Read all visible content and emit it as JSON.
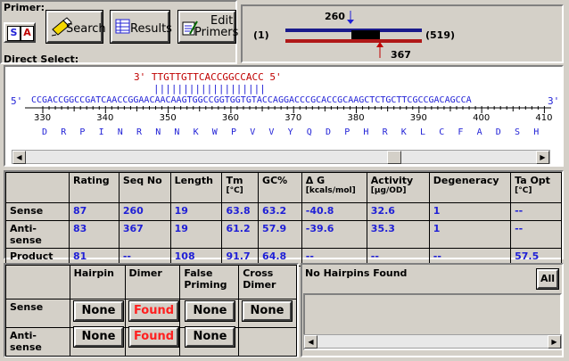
{
  "toolbar": {
    "primer_label": "Primer:",
    "sense_btn": "S",
    "antisense_btn": "A",
    "search_label": "Search",
    "results_label": "Results",
    "edit_primers_label_1": "Edit",
    "edit_primers_label_2": "Primers",
    "direct_select_label": "Direct Select:"
  },
  "map": {
    "top_pos": "260",
    "bottom_pos": "367",
    "start": "(1)",
    "end": "(519)"
  },
  "sequence": {
    "antisense_primer": "3' TTGTTGTTCACCGGCCACC 5'",
    "ticks": "|||||||||||||||||||",
    "left_end": "5'",
    "right_end": "3'",
    "dna": "CCGACCGGCCGATCAACCGGAACAACAAGTGGCCGGTGGTGTACCAGGACCCGCACCGCAAGCTCTGCTTCGCCGACAGCCA",
    "ruler": [
      "330",
      "340",
      "350",
      "360",
      "370",
      "380",
      "390",
      "400",
      "410"
    ],
    "protein": [
      "D",
      "R",
      "P",
      "I",
      "N",
      "R",
      "N",
      "N",
      "K",
      "W",
      "P",
      "V",
      "V",
      "Y",
      "Q",
      "D",
      "P",
      "H",
      "R",
      "K",
      "L",
      "C",
      "F",
      "A",
      "D",
      "S",
      "H"
    ]
  },
  "results": {
    "headers": [
      "",
      "Rating",
      "Seq No",
      "Length",
      "Tm",
      "GC%",
      "Δ G",
      "Activity",
      "Degeneracy",
      "Ta Opt"
    ],
    "subheaders": [
      "",
      "",
      "",
      "",
      "[°C]",
      "",
      "[kcals/mol]",
      "[µg/OD]",
      "",
      "[°C]"
    ],
    "rows": [
      {
        "label": "Sense",
        "values": [
          "87",
          "260",
          "19",
          "63.8",
          "63.2",
          "-40.8",
          "32.6",
          "1",
          "--"
        ]
      },
      {
        "label": "Anti-sense",
        "values": [
          "83",
          "367",
          "19",
          "61.2",
          "57.9",
          "-39.6",
          "35.3",
          "1",
          "--"
        ]
      },
      {
        "label": "Product",
        "values": [
          "81",
          "--",
          "108",
          "91.7",
          "64.8",
          "--",
          "--",
          "--",
          "57.5"
        ]
      }
    ]
  },
  "structures": {
    "headers": [
      "",
      "Hairpin",
      "Dimer",
      "False Priming",
      "Cross Dimer"
    ],
    "rows": [
      {
        "label": "Sense",
        "hairpin": "None",
        "dimer": "Found",
        "false_priming": "None",
        "cross_dimer": "None"
      },
      {
        "label": "Anti-sense",
        "hairpin": "None",
        "dimer": "Found",
        "false_priming": "None"
      }
    ],
    "message": "No Hairpins Found",
    "all_button": "All"
  },
  "colors": {
    "accent_blue": "#1f1fd6",
    "found_red": "#ff2020",
    "primer_red": "#c00000"
  }
}
